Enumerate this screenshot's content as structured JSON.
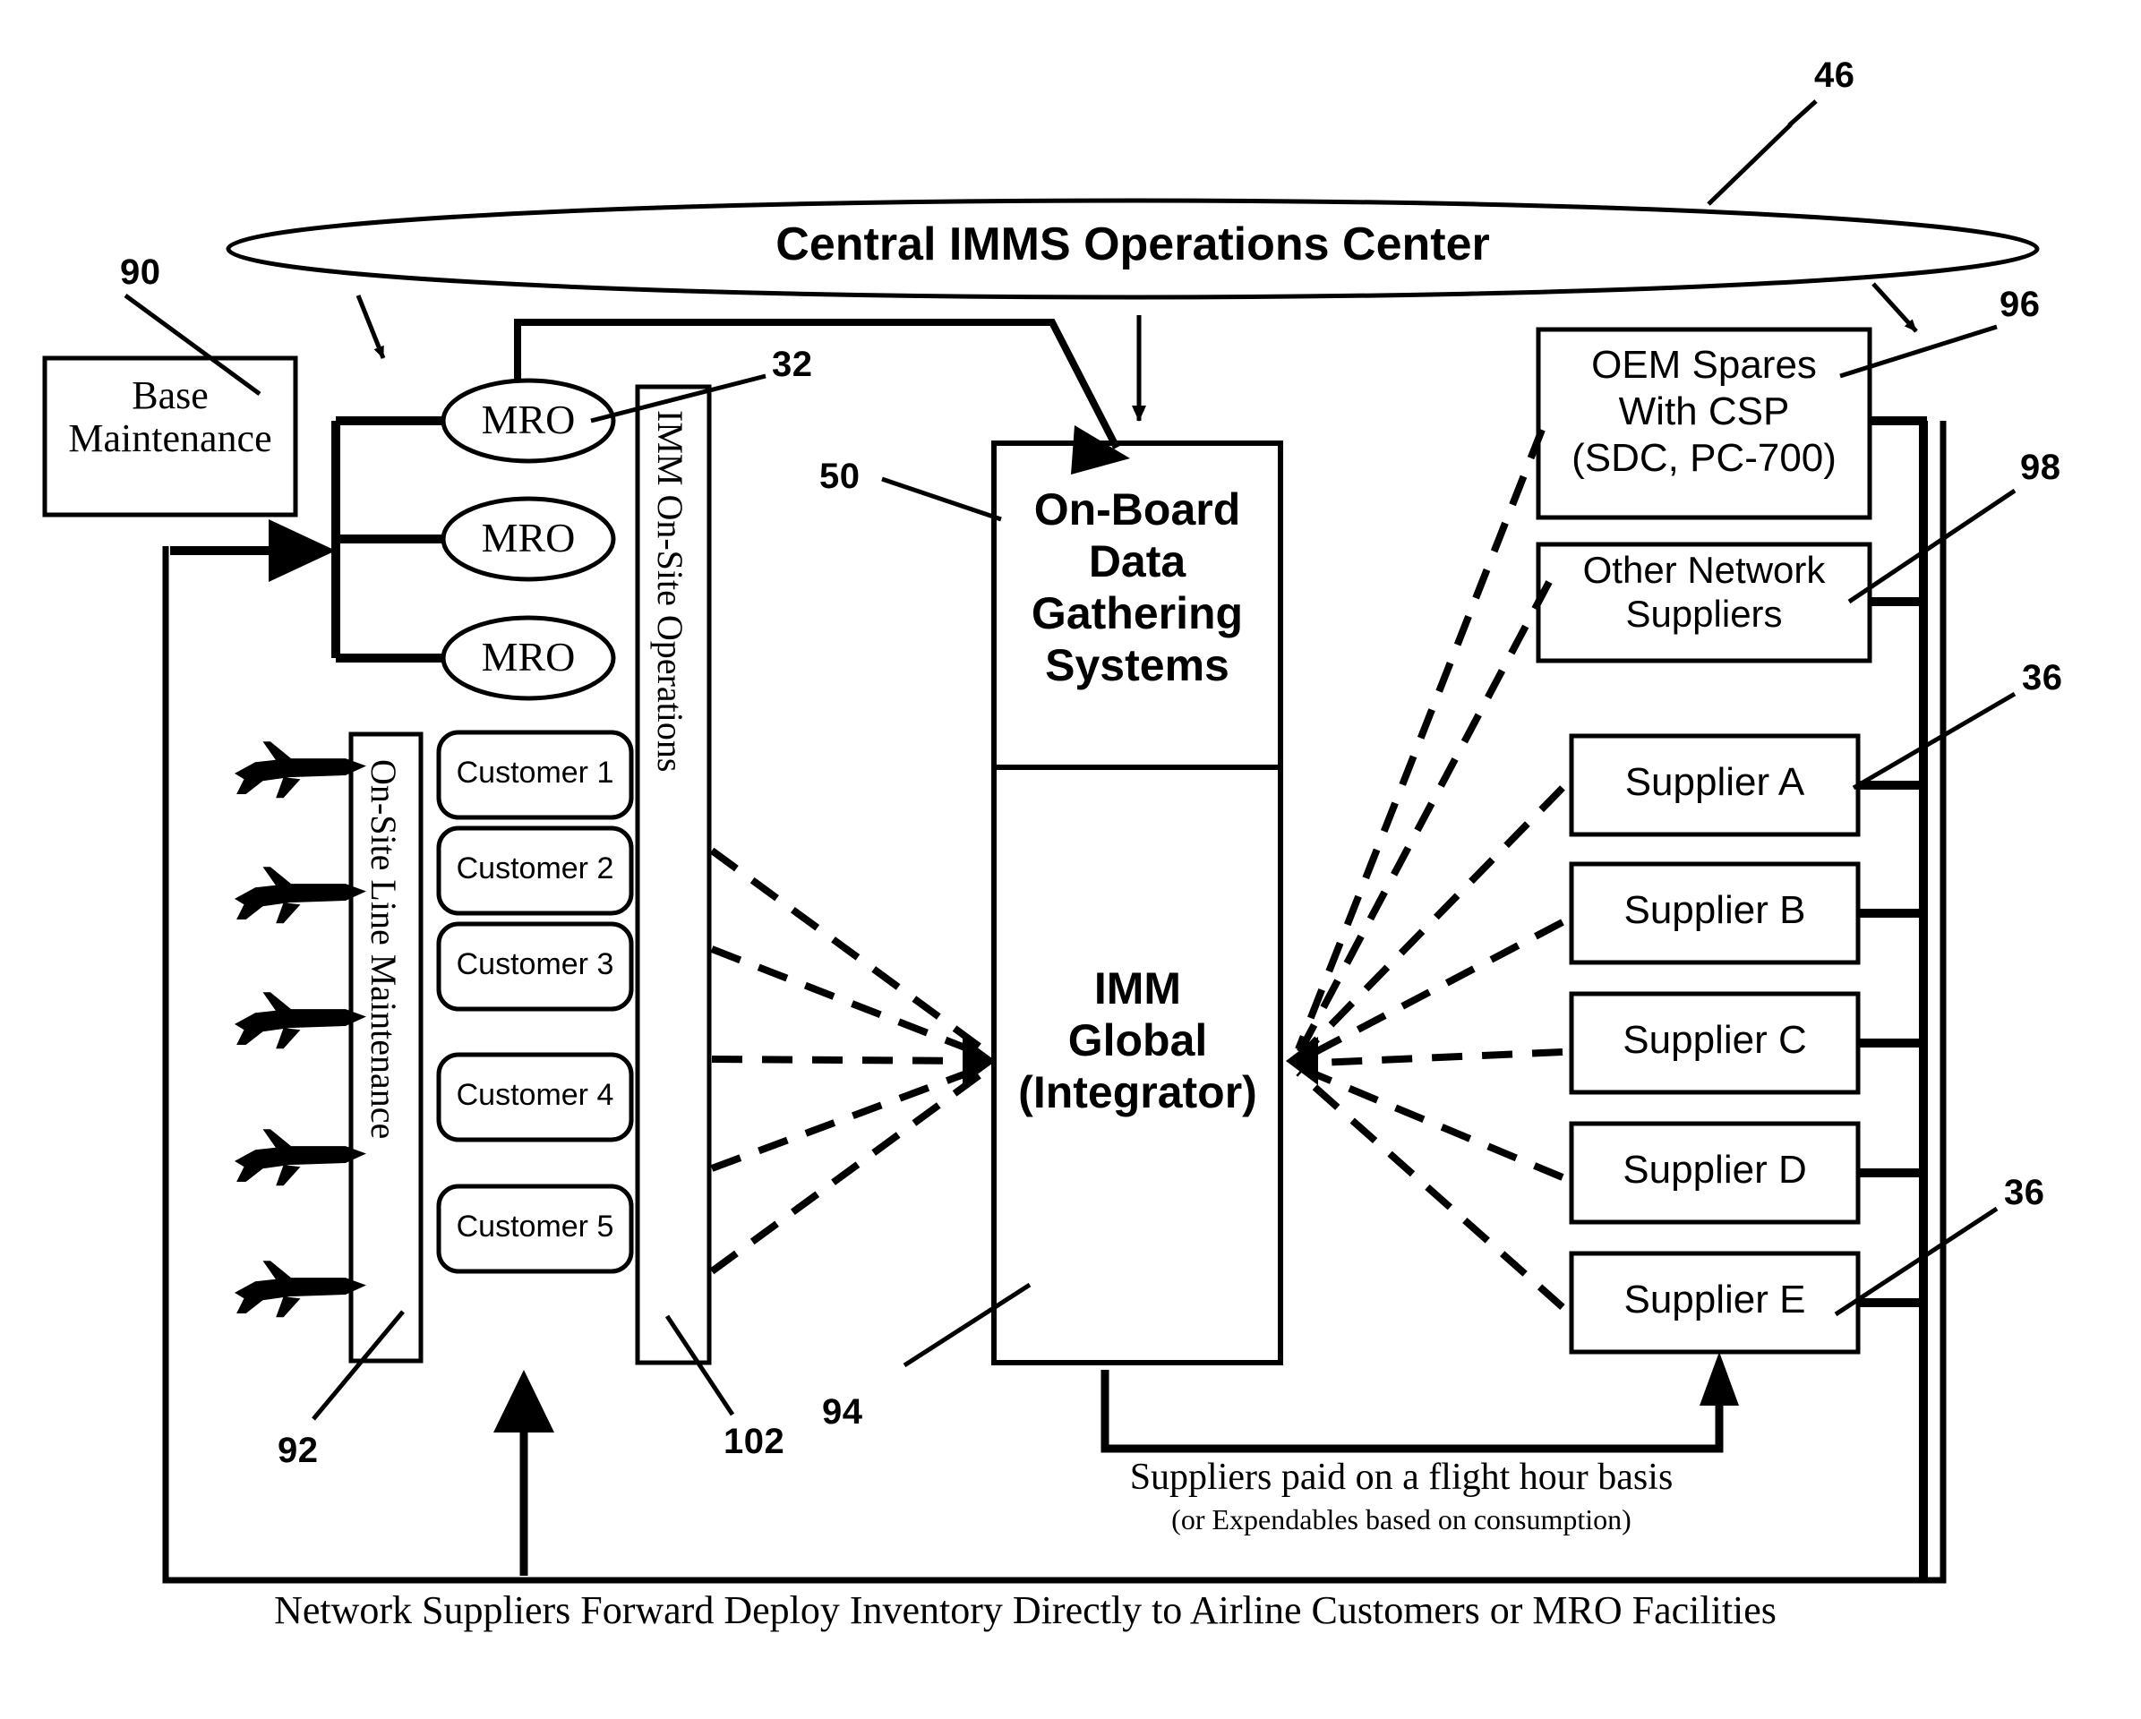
{
  "figure": {
    "title": "Central IMMS Operations Center",
    "bottom_caption": "Network Suppliers Forward Deploy Inventory Directly to Airline Customers or MRO Facilities"
  },
  "nodes": {
    "central_ops": "Central IMMS Operations Center",
    "base_maintenance": "Base\nMaintenance",
    "mro": [
      "MRO",
      "MRO",
      "MRO"
    ],
    "on_site_line_maintenance": "On-Site Line Maintenance",
    "imm_on_site_operations": "IMM On-Site Operations",
    "customers": [
      "Customer 1",
      "Customer 2",
      "Customer 3",
      "Customer 4",
      "Customer 5"
    ],
    "on_board_data": "On-Board\nData\nGathering\nSystems",
    "imm_global": "IMM\nGlobal\n(Integrator)",
    "oem_spares": "OEM Spares\nWith CSP\n(SDC, PC-700)",
    "other_network_suppliers": "Other Network\nSuppliers",
    "suppliers": [
      "Supplier A",
      "Supplier B",
      "Supplier C",
      "Supplier D",
      "Supplier E"
    ]
  },
  "annotations": {
    "payment_line1": "Suppliers paid on a flight hour basis",
    "payment_line2": "(or Expendables based on consumption)",
    "bottom_flow": "Network Suppliers Forward Deploy Inventory Directly to Airline Customers or MRO Facilities"
  },
  "reference_numerals": {
    "ref_46": "46",
    "ref_90": "90",
    "ref_96": "96",
    "ref_98": "98",
    "ref_32": "32",
    "ref_50": "50",
    "ref_36_upper": "36",
    "ref_36_lower": "36",
    "ref_92": "92",
    "ref_94": "94",
    "ref_102": "102"
  },
  "colors": {
    "stroke": "#000000",
    "background": "#ffffff"
  },
  "icons": {
    "aircraft": "airplane-icon",
    "aircraft_count": 5
  }
}
